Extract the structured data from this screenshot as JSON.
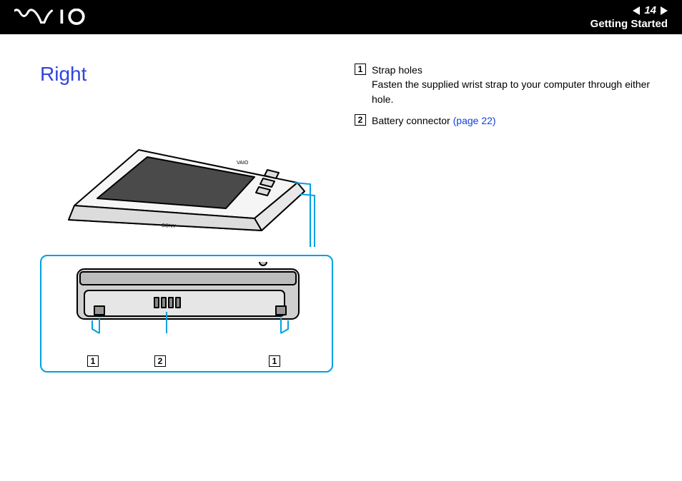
{
  "header": {
    "logo_alt": "VAIO",
    "page_number": "14",
    "section": "Getting Started"
  },
  "page": {
    "title": "Right"
  },
  "callouts": {
    "n1": "1",
    "n2": "2"
  },
  "legend": {
    "items": [
      {
        "num": "1",
        "title": "Strap holes",
        "desc": "Fasten the supplied wrist strap to your computer through either hole.",
        "link": ""
      },
      {
        "num": "2",
        "title": "Battery connector",
        "desc": "",
        "link": "(page 22)"
      }
    ]
  }
}
